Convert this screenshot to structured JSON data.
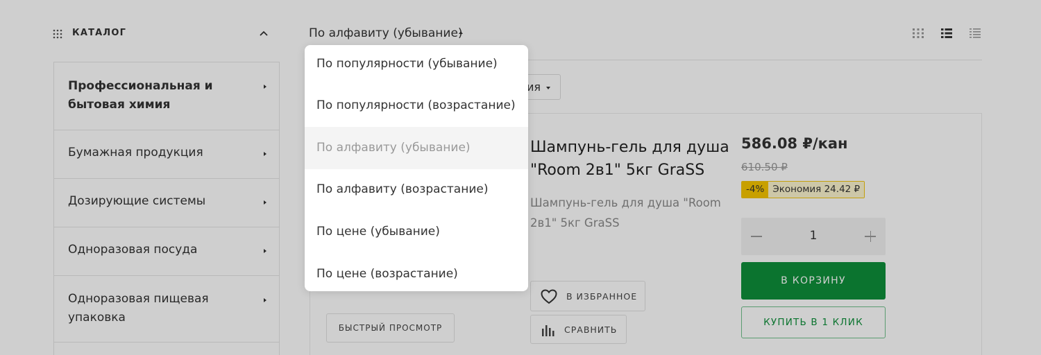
{
  "catalog": {
    "title": "КАТАЛОГ",
    "items": [
      {
        "label": "Профессиональная и бытовая химия",
        "bold": true
      },
      {
        "label": "Бумажная продукция"
      },
      {
        "label": "Дозирующие системы"
      },
      {
        "label": "Одноразовая посуда"
      },
      {
        "label": "Одноразовая пищевая упаковка"
      }
    ]
  },
  "sort": {
    "current": "По алфавиту (убывание)",
    "options": [
      "По популярности (убывание)",
      "По популярности (возрастание)",
      "По алфавиту (убывание)",
      "По алфавиту (возрастание)",
      "По цене (убывание)",
      "По цене (возрастание)"
    ],
    "active_index": 2
  },
  "filter_chip": {
    "label_fragment": "ия"
  },
  "product": {
    "name": "Шампунь-гель для душа \"Room 2в1\" 5кг GraSS",
    "description": "Шампунь-гель для душа \"Room 2в1\" 5кг GraSS",
    "price": "586.08 ₽/кан",
    "old_price": "610.50 ₽",
    "discount_percent": "-4%",
    "savings": "Экономия 24.42 ₽",
    "quantity": "1",
    "add_to_cart": "В КОРЗИНУ",
    "buy_one_click": "КУПИТЬ В 1 КЛИК",
    "favorite": "В ИЗБРАННОЕ",
    "compare": "СРАВНИТЬ",
    "quick_view": "БЫСТРЫЙ ПРОСМОТР"
  },
  "colors": {
    "accent_green": "#0e8f3a",
    "discount_yellow": "#f7c600",
    "overlay": "rgba(0,0,0,0.19)"
  },
  "icons": [
    "catalog-grid-icon",
    "chevron-up-icon",
    "sort-caret-icon",
    "view-grid-icon",
    "view-list-icon",
    "view-compact-list-icon",
    "heart-icon",
    "compare-bars-icon"
  ]
}
